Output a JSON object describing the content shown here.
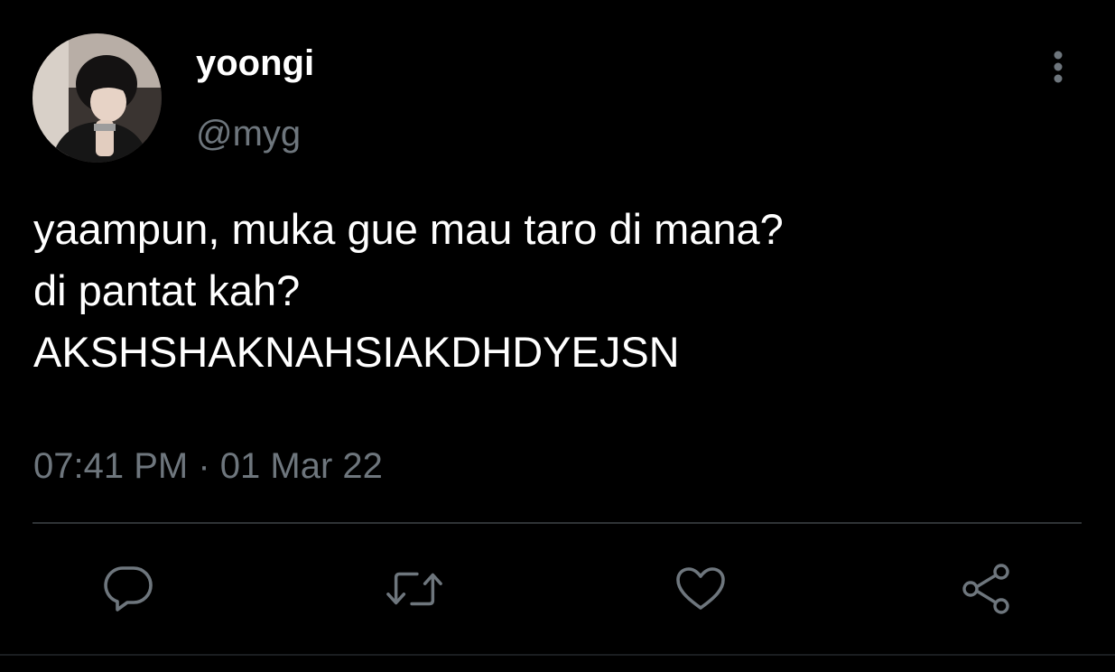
{
  "tweet": {
    "author": {
      "display_name": "yoongi",
      "handle": "@myg"
    },
    "text_lines": [
      "yaampun, muka gue mau taro di mana?",
      "di pantat kah?",
      "AKSHSHAKNAHSIAKDHDYEJSN"
    ],
    "time": "07:41 PM",
    "separator": "·",
    "date": "01 Mar 22"
  },
  "actions": {
    "reply_icon": "speech-bubble",
    "retweet_icon": "retweet-arrows",
    "like_icon": "heart",
    "share_icon": "share-nodes"
  },
  "colors": {
    "background": "#000000",
    "text": "#ffffff",
    "secondary_text": "#6e767d",
    "icon": "#6e767d",
    "divider": "#2f3336"
  }
}
